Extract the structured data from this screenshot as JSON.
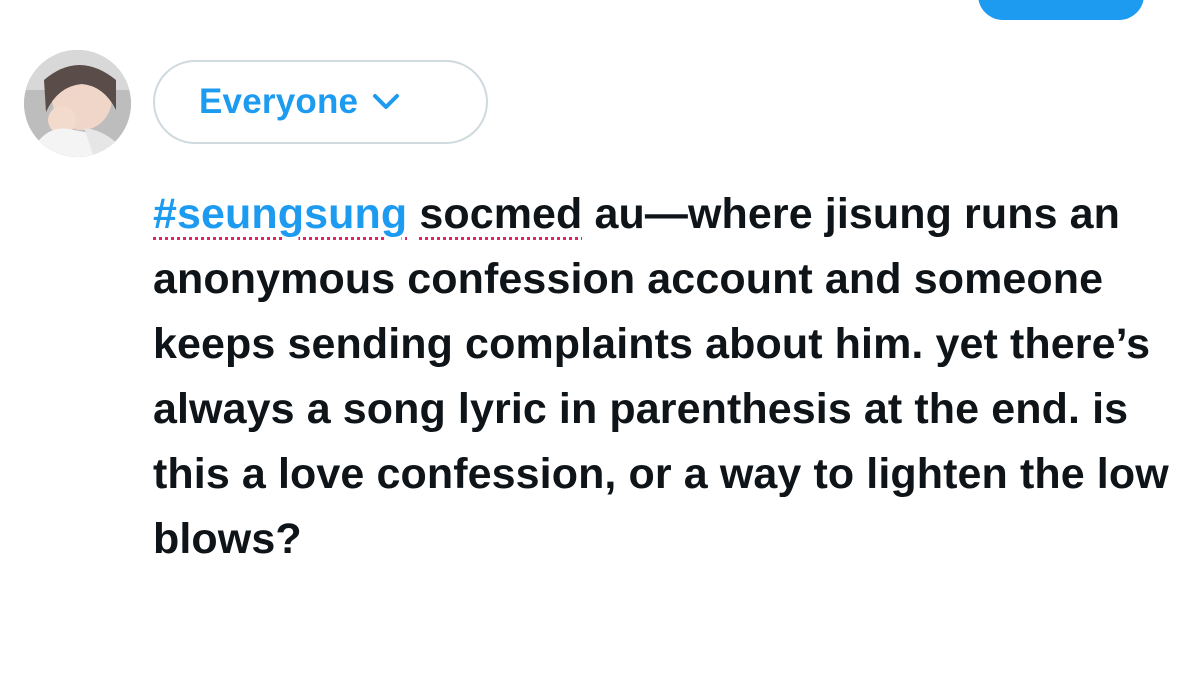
{
  "composer": {
    "audience_label": "Everyone",
    "text": {
      "hashtag": "#seungsung",
      "space1": " ",
      "misspelled_word": "socmed",
      "rest": " au—where jisung runs an anonymous confession account and someone keeps sending complaints about him. yet there’s always a song lyric in parenthesis at the end. is this a love confession, or a way to lighten the low blows?"
    }
  },
  "colors": {
    "accent": "#1d9bf0",
    "text": "#0f1419",
    "border": "#cfd9de",
    "spellcheck": "#e0245e"
  },
  "icons": {
    "audience_chevron": "chevron-down-icon"
  }
}
